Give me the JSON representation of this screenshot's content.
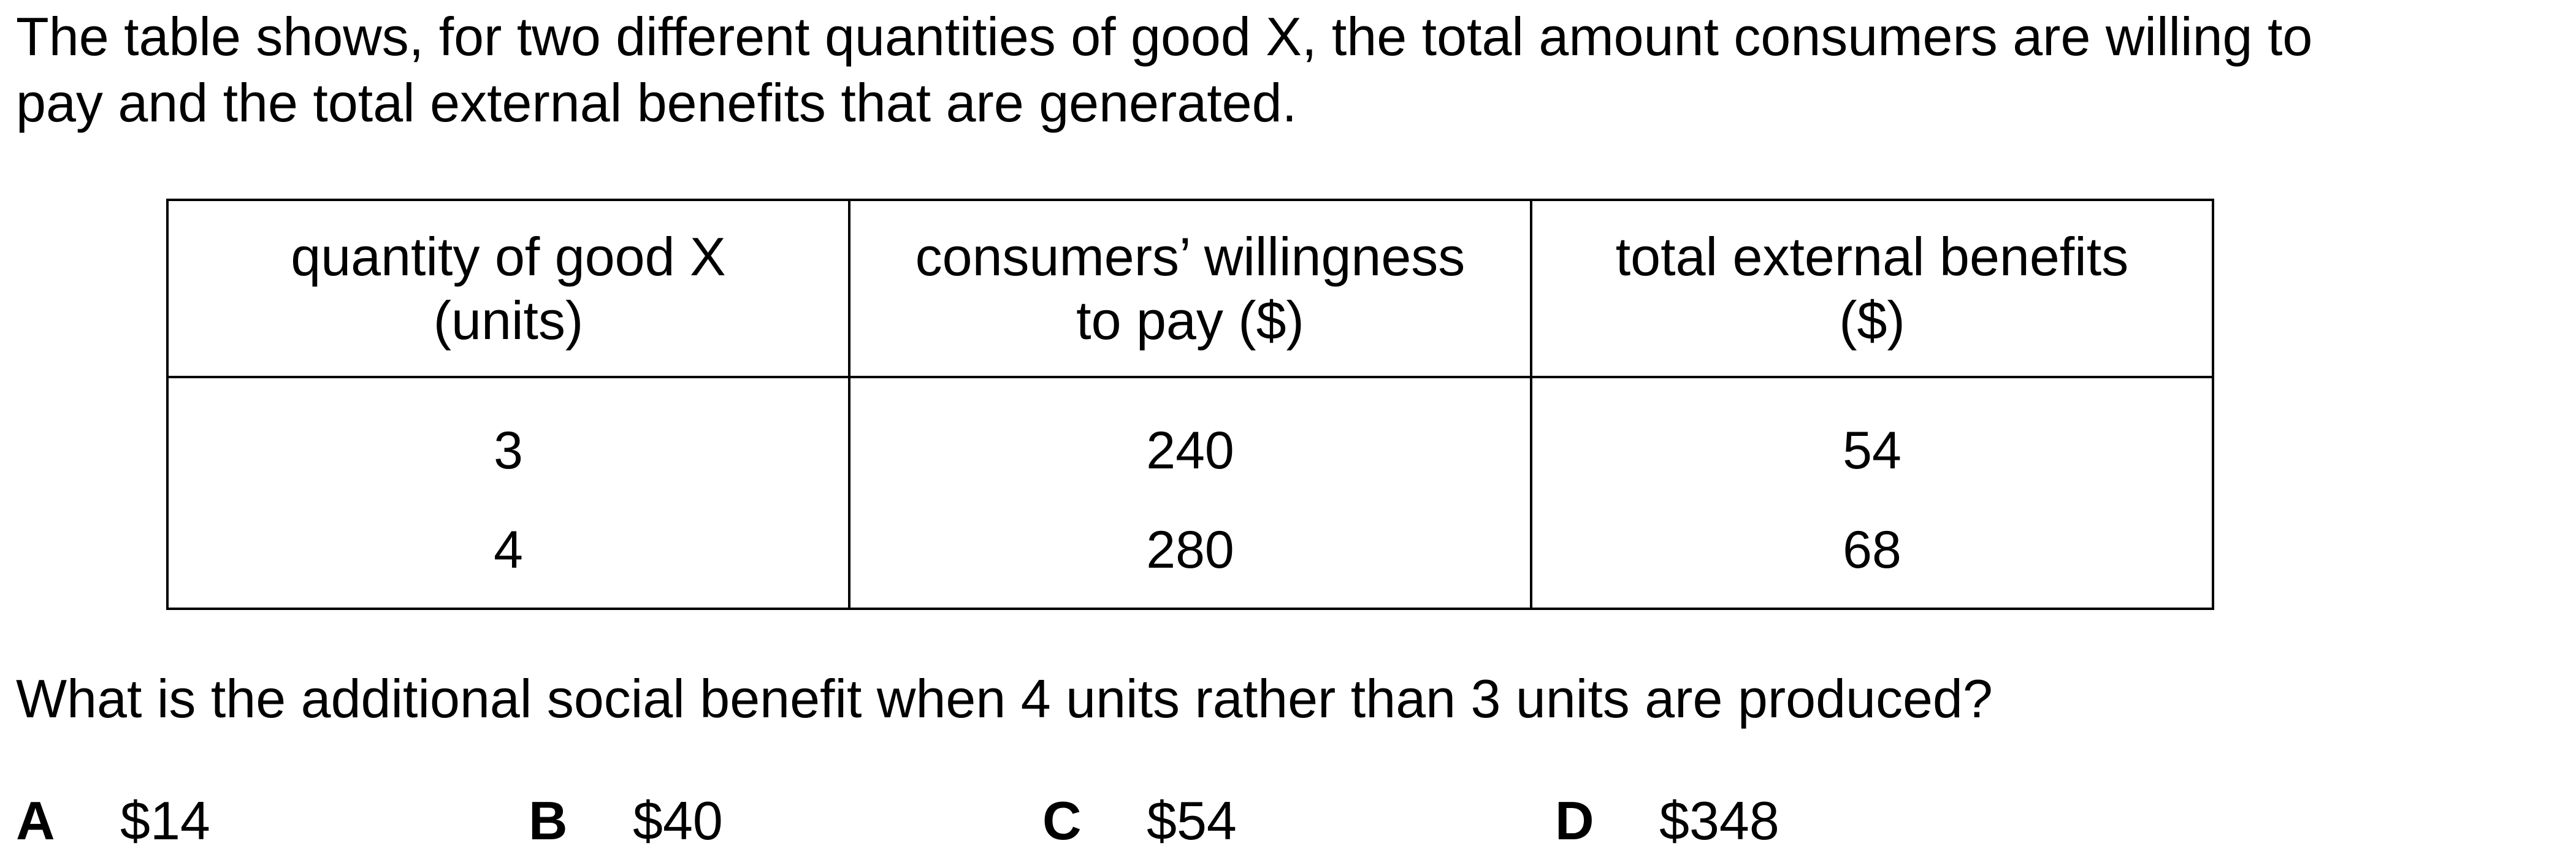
{
  "intro": {
    "line1": "The table shows, for two different quantities of good X, the total amount consumers are willing to",
    "line2": "pay and the total external benefits that are generated."
  },
  "table": {
    "headers": [
      {
        "line1": "quantity of good X",
        "line2": "(units)"
      },
      {
        "line1": "consumers’ willingness",
        "line2": "to pay ($)"
      },
      {
        "line1": "total external benefits",
        "line2": "($)"
      }
    ],
    "rows": [
      [
        "3",
        "240",
        "54"
      ],
      [
        "4",
        "280",
        "68"
      ]
    ]
  },
  "question": "What is the additional social benefit when 4 units rather than 3 units are produced?",
  "options": [
    {
      "letter": "A",
      "text": "$14"
    },
    {
      "letter": "B",
      "text": "$40"
    },
    {
      "letter": "C",
      "text": "$54"
    },
    {
      "letter": "D",
      "text": "$348"
    }
  ]
}
